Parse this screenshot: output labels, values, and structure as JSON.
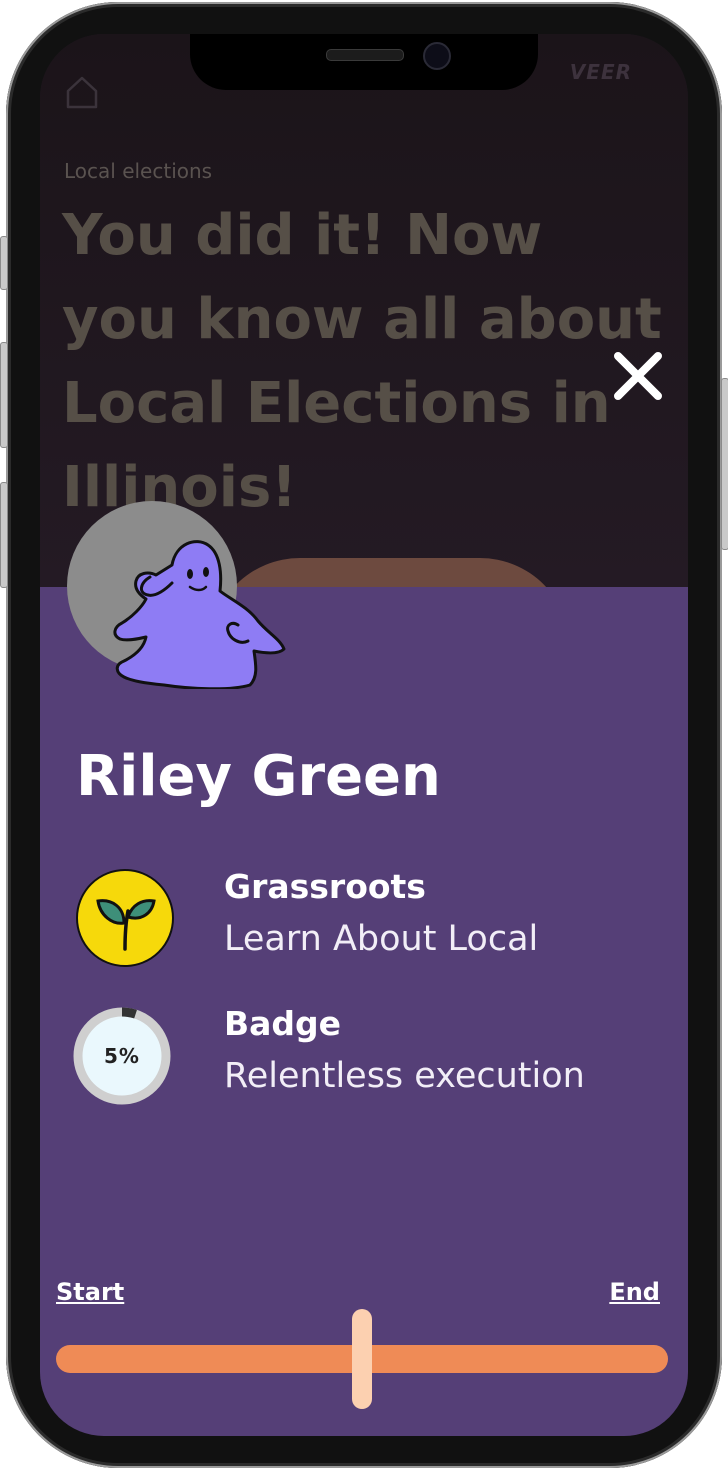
{
  "background_page": {
    "brand": "VEER",
    "breadcrumb": "Local elections",
    "title": "You did it! Now you know all about Local Elections in Illinois!"
  },
  "modal": {
    "close_icon": "close-icon",
    "user_name": "Riley Green",
    "achievements": [
      {
        "title": "Grassroots",
        "subtitle": "Learn About Local",
        "icon": "sprout-icon"
      },
      {
        "title": "Badge",
        "subtitle": "Relentless execution",
        "progress_label": "5%",
        "progress": 0.05
      }
    ],
    "slider": {
      "start_label": "Start",
      "end_label": "End",
      "value": 0.5
    }
  },
  "colors": {
    "sheet": "#553f77",
    "track": "#ef8b56",
    "thumb": "#fcd0b0",
    "leaf_badge": "#f6d90b"
  }
}
